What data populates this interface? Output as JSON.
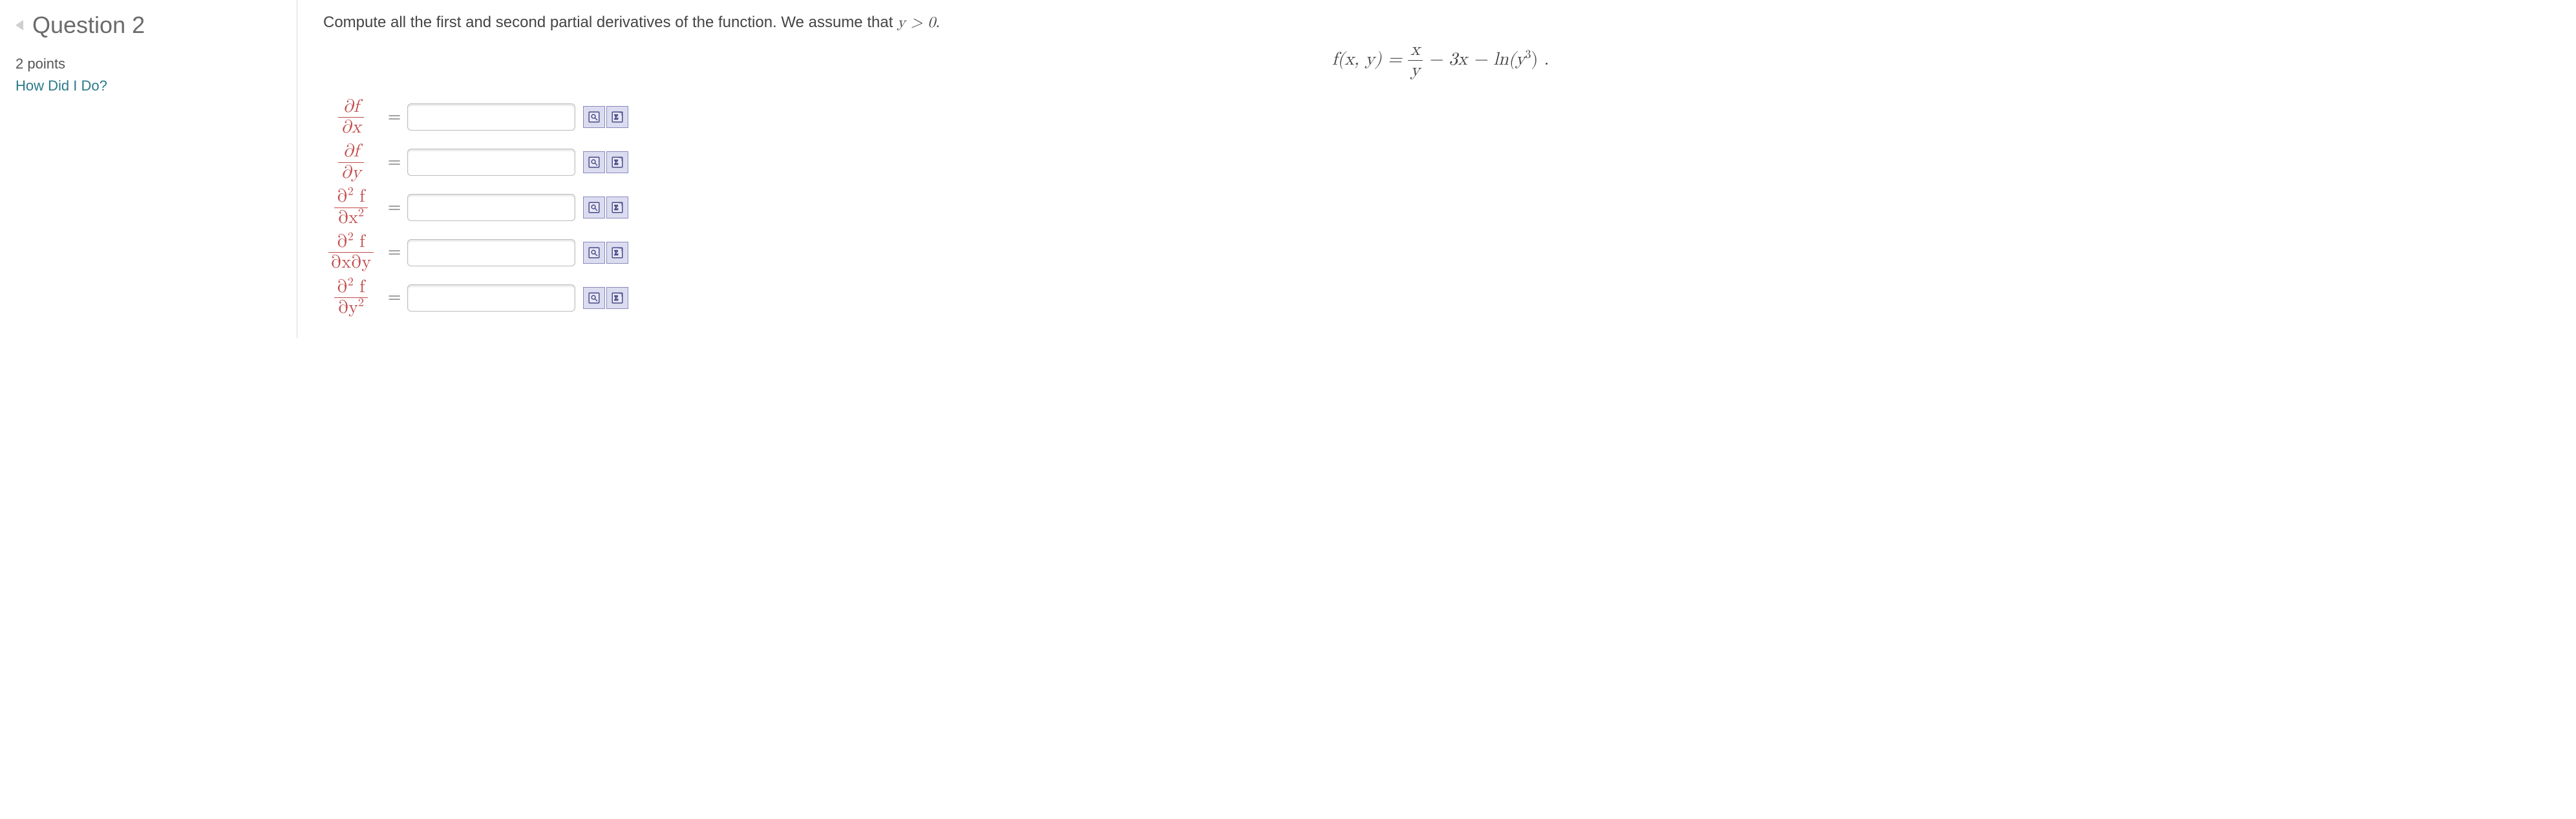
{
  "sidebar": {
    "title": "Question 2",
    "points": "2 points",
    "how_link": "How Did I Do?"
  },
  "prompt": {
    "text_before": "Compute all the first and second partial derivatives of the function. We assume that ",
    "condition": "y > 0",
    "text_after": "."
  },
  "function": {
    "lhs": "f(x, y) =",
    "frac_num": "x",
    "frac_den": "y",
    "tail_a": " − 3x − ln(y",
    "tail_exp": "3",
    "tail_b": ") ."
  },
  "rows": [
    {
      "num": "∂f",
      "den": "∂x"
    },
    {
      "num": "∂f",
      "den": "∂y"
    },
    {
      "num": "∂²f",
      "den": "∂x²",
      "num_html": "∂<span class='sup'>2</span> f",
      "den_html": "∂x<span class='sup'>2</span>"
    },
    {
      "num": "∂²f",
      "den": "∂x∂y",
      "num_html": "∂<span class='sup'>2</span> f",
      "den_html": "∂x∂y"
    },
    {
      "num": "∂²f",
      "den": "∂y²",
      "num_html": "∂<span class='sup'>2</span> f",
      "den_html": "∂y<span class='sup'>2</span>"
    }
  ],
  "eq": "="
}
